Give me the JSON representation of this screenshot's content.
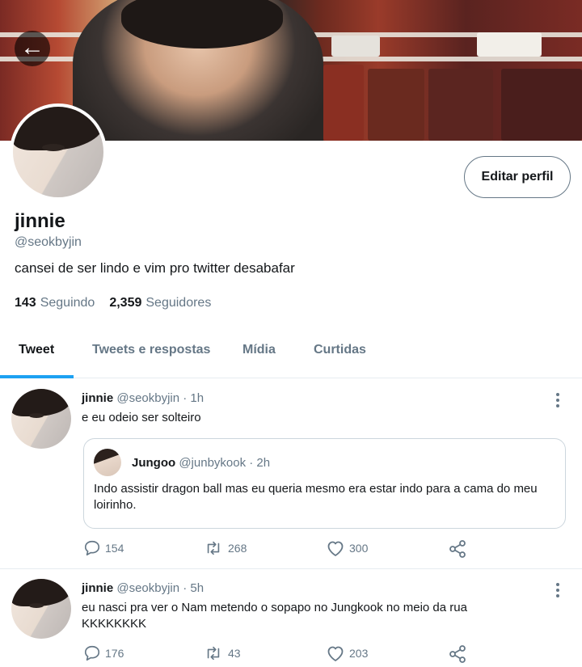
{
  "profile": {
    "name": "jinnie",
    "handle": "@seokbyjin",
    "bio": "cansei de ser lindo e vim pro twitter desabafar",
    "following_count": "143",
    "following_label": "Seguindo",
    "followers_count": "2,359",
    "followers_label": "Seguidores",
    "edit_label": "Editar perfil"
  },
  "tabs": [
    {
      "label": "Tweet",
      "active": true
    },
    {
      "label": "Tweets e respostas",
      "active": false
    },
    {
      "label": "Mídia",
      "active": false
    },
    {
      "label": "Curtidas",
      "active": false
    }
  ],
  "tweets": [
    {
      "name": "jinnie",
      "meta": "@seokbyjin · 1h",
      "text": "e eu odeio ser solteiro",
      "quote": {
        "name": "Jungoo",
        "meta": "@junbykook · 2h",
        "text": "Indo assistir dragon ball mas eu queria mesmo era estar indo para a cama do meu loirinho."
      },
      "replies": "154",
      "retweets": "268",
      "likes": "300"
    },
    {
      "name": "jinnie",
      "meta": "@seokbyjin · 5h",
      "text": "eu nasci pra ver o Nam metendo o sopapo no Jungkook no meio da rua KKKKKKKK",
      "replies": "176",
      "retweets": "43",
      "likes": "203"
    }
  ],
  "icons": {
    "back": "arrow-left-icon",
    "reply": "reply-icon",
    "retweet": "retweet-icon",
    "like": "heart-icon",
    "share": "share-icon",
    "more": "more-vertical-icon"
  },
  "colors": {
    "accent": "#1da1f2",
    "text": "#14171a",
    "secondary": "#657786",
    "border": "#e6ecf0"
  }
}
